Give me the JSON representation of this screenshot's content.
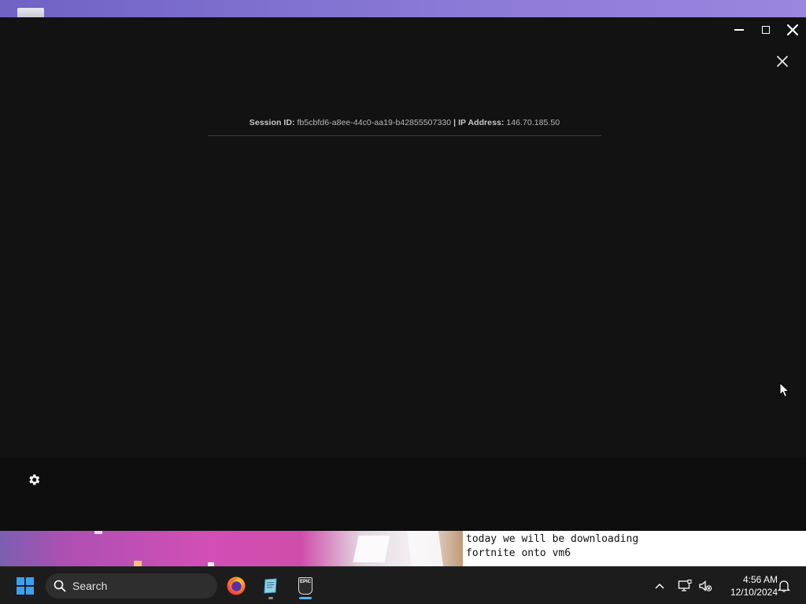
{
  "window": {
    "controls": {
      "minimize_icon": "minimize-icon",
      "maximize_icon": "maximize-icon",
      "close_icon": "close-icon"
    },
    "dialog_close_icon": "close-icon"
  },
  "session": {
    "session_id_label": "Session ID:",
    "session_id_value": "fb5cbfd6-a8ee-44c0-aa19-b42855507330",
    "separator": "|",
    "ip_label": "IP Address:",
    "ip_value": "146.70.185.50"
  },
  "settings": {
    "icon": "gear-icon"
  },
  "caption": {
    "line1": "today we will be downloading",
    "line2": "fortnite onto vm6"
  },
  "taskbar": {
    "search_placeholder": "Search",
    "apps": [
      {
        "name": "Firefox",
        "icon": "firefox-icon"
      },
      {
        "name": "Notepad",
        "icon": "notepad-icon"
      },
      {
        "name": "Epic Games",
        "icon": "epic-games-icon",
        "logo_text_top": "EPIC",
        "logo_text_bottom": "GAMES"
      }
    ],
    "tray": {
      "chevron_icon": "chevron-up-icon",
      "network_icon": "network-icon",
      "volume_icon": "volume-muted-icon",
      "notification_icon": "bell-icon"
    },
    "time": "4:56 AM",
    "date": "12/10/2024"
  },
  "colors": {
    "app_background": "#121212",
    "taskbar_background": "#1c1c1c",
    "accent": "#3aa0f0",
    "caption_background": "#ffffff"
  }
}
